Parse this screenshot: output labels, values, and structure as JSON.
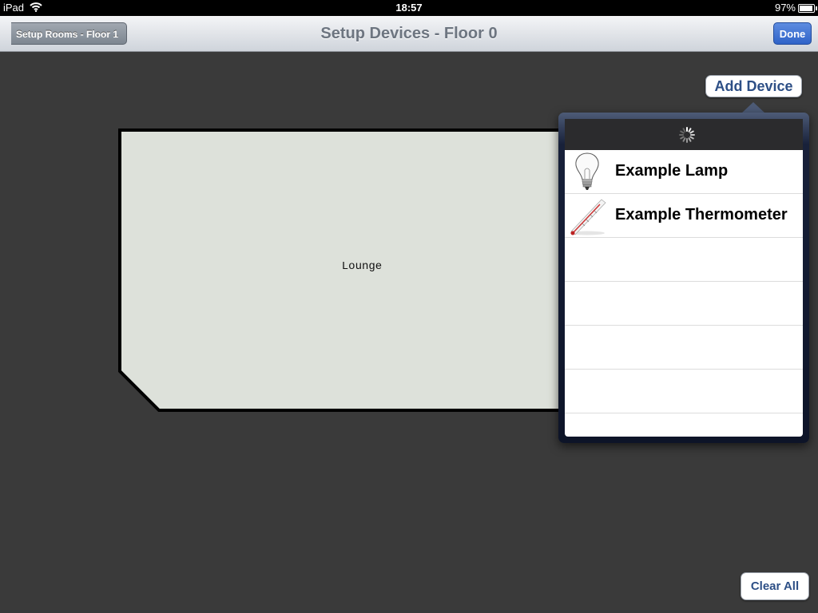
{
  "status_bar": {
    "device": "iPad",
    "time": "18:57",
    "battery_percent_label": "97%",
    "battery_level": 0.97,
    "icons": [
      "wifi-icon",
      "battery-icon"
    ]
  },
  "nav": {
    "back_label": "Setup Rooms - Floor 1",
    "title": "Setup Devices - Floor 0",
    "done_label": "Done"
  },
  "room": {
    "label": "Lounge",
    "fill_color": "#dde1da",
    "border_color": "#000000"
  },
  "add_device_label": "Add Device",
  "popover": {
    "loading": true,
    "items": [
      {
        "label": "Example Lamp",
        "icon": "lightbulb-icon"
      },
      {
        "label": "Example Thermometer",
        "icon": "thermometer-icon"
      }
    ]
  },
  "clear_all_label": "Clear All",
  "colors": {
    "background": "#3a3a3a",
    "accent_blue": "#2f63c8",
    "button_text": "#2d4f86"
  }
}
